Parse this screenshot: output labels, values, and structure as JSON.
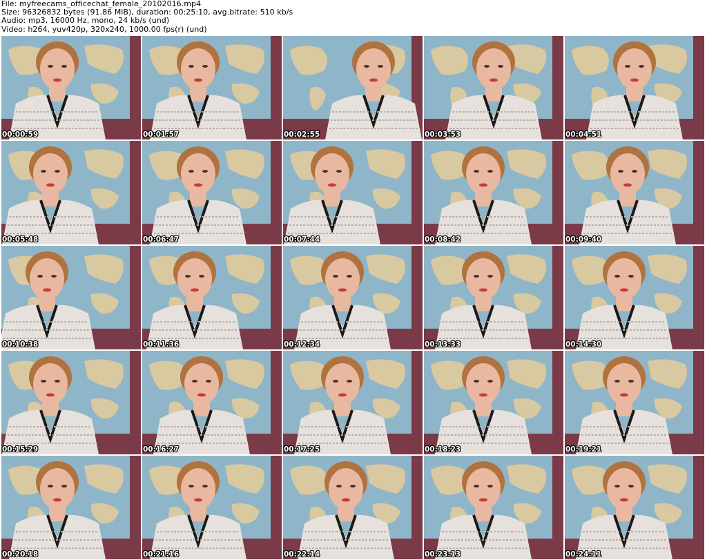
{
  "header": {
    "file_line": "File: myfreecams_officechat_female_20102016.mp4",
    "size_line": "Size: 96326832 bytes (91.86 MiB), duration: 00:25:10, avg.bitrate: 510 kb/s",
    "audio_line": "Audio: mp3, 16000 Hz, mono, 24 kb/s (und)",
    "video_line": "Video: h264, yuv420p, 320x240, 1000.00 fps(r) (und)"
  },
  "thumbnails": [
    {
      "timestamp": "00:00:59"
    },
    {
      "timestamp": "00:01:57"
    },
    {
      "timestamp": "00:02:55"
    },
    {
      "timestamp": "00:03:53"
    },
    {
      "timestamp": "00:04:51"
    },
    {
      "timestamp": "00:05:48"
    },
    {
      "timestamp": "00:06:47"
    },
    {
      "timestamp": "00:07:44"
    },
    {
      "timestamp": "00:08:42"
    },
    {
      "timestamp": "00:09:40"
    },
    {
      "timestamp": "00:10:38"
    },
    {
      "timestamp": "00:11:36"
    },
    {
      "timestamp": "00:12:34"
    },
    {
      "timestamp": "00:13:33"
    },
    {
      "timestamp": "00:14:30"
    },
    {
      "timestamp": "00:15:29"
    },
    {
      "timestamp": "00:16:27"
    },
    {
      "timestamp": "00:17:25"
    },
    {
      "timestamp": "00:18:23"
    },
    {
      "timestamp": "00:19:21"
    },
    {
      "timestamp": "00:20:18"
    },
    {
      "timestamp": "00:21:16"
    },
    {
      "timestamp": "00:22:14"
    },
    {
      "timestamp": "00:23:13"
    },
    {
      "timestamp": "00:24:11"
    }
  ],
  "colors": {
    "wall": "#7a3a48",
    "map_ocean": "#8fb5c8",
    "map_land": "#d9c9a0",
    "skin": "#e8b9a0",
    "hair": "#b0723e",
    "sweater": "#e6e1dc",
    "sweater_trim": "#1a1a1a",
    "lips": "#c83a3a"
  }
}
